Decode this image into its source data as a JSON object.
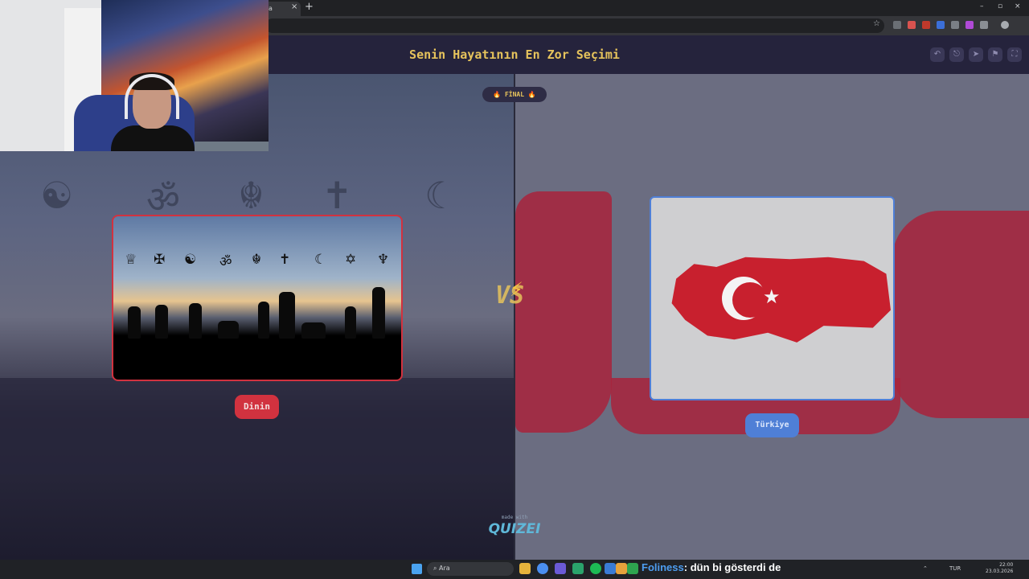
{
  "browser": {
    "tab_title": "a",
    "tab_close": "×",
    "new_tab": "+",
    "window_controls": [
      "–",
      "▫",
      "×"
    ],
    "bookmark_icon": "☆"
  },
  "app": {
    "title": "Senin Hayatının En Zor Seçimi",
    "header_icons": [
      "undo-icon",
      "share-icon",
      "send-icon",
      "flag-icon",
      "fullscreen-icon"
    ],
    "header_glyphs": [
      "↶",
      "⎋",
      "➤",
      "⚑",
      "⛶"
    ],
    "round_badge": "🔥 FİNAL 🔥",
    "vs_label": "VS",
    "vs_bolt": "⚡",
    "made_with": "made with",
    "brand": "QUIZEI"
  },
  "left_option": {
    "label": "Dinin",
    "accent": "#d1323f",
    "symbols": [
      "♕",
      "✠",
      "☯",
      "ॐ",
      "☬",
      "✝",
      "☾",
      "✡",
      "♆"
    ],
    "bg_symbols": [
      "☯",
      "ॐ",
      "☬",
      "✝",
      "☾"
    ]
  },
  "right_option": {
    "label": "Türkiye",
    "accent": "#4f7fd6",
    "flag_star": "★"
  },
  "taskbar": {
    "search_placeholder": "Ara",
    "chat_user": "Foliness",
    "chat_message": ": dün bi gösterdi de",
    "tray_lang": "TUR",
    "tray_arrow": "⌃",
    "time": "22:00",
    "date": "23.03.2026"
  }
}
